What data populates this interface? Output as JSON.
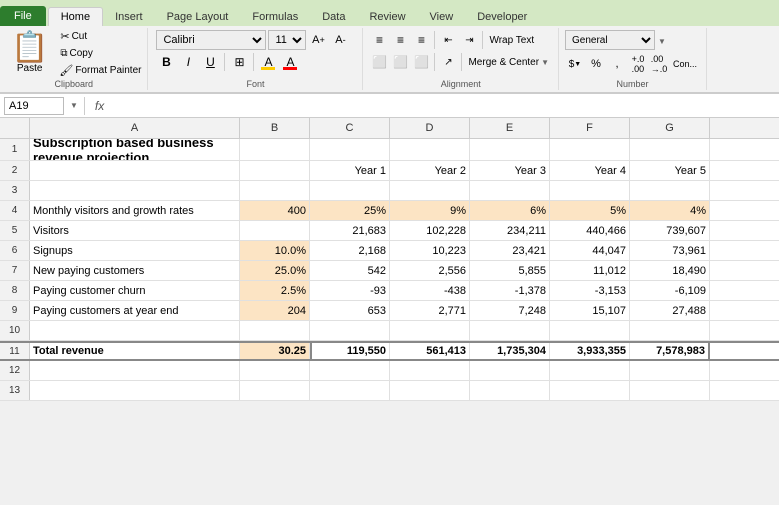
{
  "tabs": {
    "file": "File",
    "home": "Home",
    "insert": "Insert",
    "page_layout": "Page Layout",
    "formulas": "Formulas",
    "data": "Data",
    "review": "Review",
    "view": "View",
    "developer": "Developer"
  },
  "clipboard": {
    "paste": "Paste",
    "cut": "Cut",
    "copy": "Copy",
    "format_painter": "Format Painter",
    "label": "Clipboard"
  },
  "font": {
    "name": "Calibri",
    "size": "11",
    "bold": "B",
    "italic": "I",
    "underline": "U",
    "label": "Font"
  },
  "alignment": {
    "label": "Alignment",
    "wrap_text": "Wrap Text",
    "merge_center": "Merge & Center"
  },
  "number": {
    "format": "General",
    "label": "Number"
  },
  "formula_bar": {
    "cell_ref": "A19",
    "fx": "fx"
  },
  "columns": [
    "A",
    "B",
    "C",
    "D",
    "E",
    "F",
    "G"
  ],
  "spreadsheet": {
    "title": "Subscription based business revenue projection",
    "headers": {
      "row": 2,
      "values": [
        "",
        "",
        "Year 1",
        "Year 2",
        "Year 3",
        "Year 4",
        "Year 5"
      ]
    },
    "rows": [
      {
        "num": 1,
        "cells": [
          {
            "text": "Subscription based business revenue projection",
            "bold": true,
            "colspan": 7
          }
        ]
      },
      {
        "num": 2,
        "cells": [
          "",
          "",
          "Year 1",
          "Year 2",
          "Year 3",
          "Year 4",
          "Year 5"
        ]
      },
      {
        "num": 3,
        "cells": [
          "",
          "",
          "",
          "",
          "",
          "",
          ""
        ]
      },
      {
        "num": 4,
        "cells": [
          "Monthly visitors and growth rates",
          "400",
          "25%",
          "9%",
          "6%",
          "5%",
          "4%"
        ]
      },
      {
        "num": 5,
        "cells": [
          "Visitors",
          "",
          "21,683",
          "102,228",
          "234,211",
          "440,466",
          "739,607"
        ]
      },
      {
        "num": 6,
        "cells": [
          "Signups",
          "10.0%",
          "2,168",
          "10,223",
          "23,421",
          "44,047",
          "73,961"
        ]
      },
      {
        "num": 7,
        "cells": [
          "New paying customers",
          "25.0%",
          "542",
          "2,556",
          "5,855",
          "11,012",
          "18,490"
        ]
      },
      {
        "num": 8,
        "cells": [
          "Paying  customer churn",
          "2.5%",
          "-93",
          "-438",
          "-1,378",
          "-3,153",
          "-6,109"
        ]
      },
      {
        "num": 9,
        "cells": [
          "Paying customers at year end",
          "204",
          "653",
          "2,771",
          "7,248",
          "15,107",
          "27,488"
        ]
      },
      {
        "num": 10,
        "cells": [
          "",
          "",
          "",
          "",
          "",
          "",
          ""
        ]
      },
      {
        "num": 11,
        "cells": [
          "Total revenue",
          "30.25",
          "119,550",
          "561,413",
          "1,735,304",
          "3,933,355",
          "7,578,983"
        ]
      },
      {
        "num": 12,
        "cells": [
          "",
          "",
          "",
          "",
          "",
          "",
          ""
        ]
      },
      {
        "num": 13,
        "cells": [
          "",
          "",
          "",
          "",
          "",
          "",
          ""
        ]
      }
    ]
  }
}
